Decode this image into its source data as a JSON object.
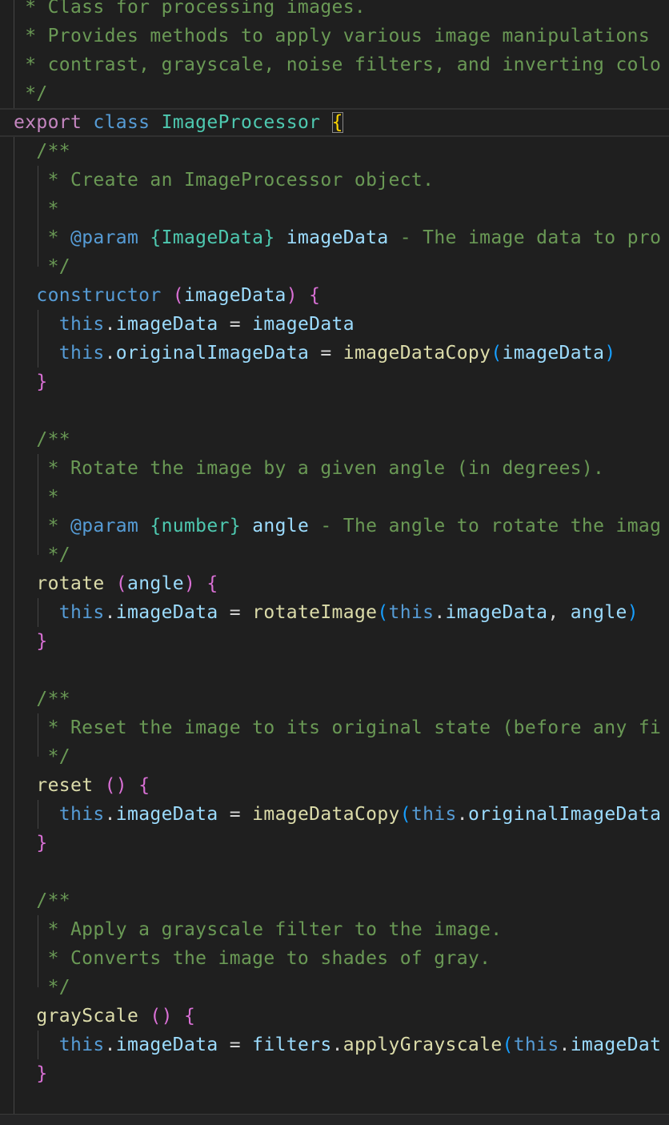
{
  "editor": {
    "colors": {
      "background": "#1f1f1f",
      "comment": "#6a9955",
      "keyword": "#c586c0",
      "storage": "#569cd6",
      "class_name": "#4ec9b0",
      "function": "#dcdcaa",
      "variable": "#9cdcfe",
      "bracket_gold": "#ffd700",
      "bracket_orchid": "#da70d6",
      "bracket_blue": "#179fff"
    },
    "lines": [
      [
        {
          "t": " * Class for processing images.",
          "c": "c-comment"
        }
      ],
      [
        {
          "t": " * Provides methods to apply various image manipulations",
          "c": "c-comment"
        }
      ],
      [
        {
          "t": " * contrast, grayscale, noise filters, and inverting colo",
          "c": "c-comment"
        }
      ],
      [
        {
          "t": " */",
          "c": "c-comment"
        }
      ],
      [
        {
          "t": "export",
          "c": "c-kw"
        },
        {
          "t": " ",
          "c": "c-plain"
        },
        {
          "t": "class",
          "c": "c-storage"
        },
        {
          "t": " ",
          "c": "c-plain"
        },
        {
          "t": "ImageProcessor",
          "c": "c-class"
        },
        {
          "t": " ",
          "c": "c-plain"
        },
        {
          "t": "{",
          "c": "c-brace1 bracket-match"
        }
      ],
      [
        {
          "t": "  /**",
          "c": "c-comment"
        }
      ],
      [
        {
          "t": "   * Create an ImageProcessor object.",
          "c": "c-comment"
        }
      ],
      [
        {
          "t": "   *",
          "c": "c-comment"
        }
      ],
      [
        {
          "t": "   * ",
          "c": "c-comment"
        },
        {
          "t": "@param",
          "c": "c-doctag"
        },
        {
          "t": " ",
          "c": "c-comment"
        },
        {
          "t": "{",
          "c": "c-doctype"
        },
        {
          "t": "ImageData",
          "c": "c-doctype"
        },
        {
          "t": "}",
          "c": "c-doctype"
        },
        {
          "t": " ",
          "c": "c-comment"
        },
        {
          "t": "imageData",
          "c": "c-docparam"
        },
        {
          "t": " - The image data to pro",
          "c": "c-comment"
        }
      ],
      [
        {
          "t": "   */",
          "c": "c-comment"
        }
      ],
      [
        {
          "t": "  ",
          "c": "c-plain"
        },
        {
          "t": "constructor",
          "c": "c-storage"
        },
        {
          "t": " ",
          "c": "c-plain"
        },
        {
          "t": "(",
          "c": "c-brace2"
        },
        {
          "t": "imageData",
          "c": "c-var"
        },
        {
          "t": ")",
          "c": "c-brace2"
        },
        {
          "t": " ",
          "c": "c-plain"
        },
        {
          "t": "{",
          "c": "c-brace2"
        }
      ],
      [
        {
          "t": "    ",
          "c": "c-plain"
        },
        {
          "t": "this",
          "c": "c-storage"
        },
        {
          "t": ".",
          "c": "c-plain"
        },
        {
          "t": "imageData",
          "c": "c-var"
        },
        {
          "t": " = ",
          "c": "c-plain"
        },
        {
          "t": "imageData",
          "c": "c-var"
        }
      ],
      [
        {
          "t": "    ",
          "c": "c-plain"
        },
        {
          "t": "this",
          "c": "c-storage"
        },
        {
          "t": ".",
          "c": "c-plain"
        },
        {
          "t": "originalImageData",
          "c": "c-var"
        },
        {
          "t": " = ",
          "c": "c-plain"
        },
        {
          "t": "imageDataCopy",
          "c": "c-func"
        },
        {
          "t": "(",
          "c": "c-brace3"
        },
        {
          "t": "imageData",
          "c": "c-var"
        },
        {
          "t": ")",
          "c": "c-brace3"
        }
      ],
      [
        {
          "t": "  ",
          "c": "c-plain"
        },
        {
          "t": "}",
          "c": "c-brace2"
        }
      ],
      [],
      [
        {
          "t": "  /**",
          "c": "c-comment"
        }
      ],
      [
        {
          "t": "   * Rotate the image by a given angle (in degrees).",
          "c": "c-comment"
        }
      ],
      [
        {
          "t": "   *",
          "c": "c-comment"
        }
      ],
      [
        {
          "t": "   * ",
          "c": "c-comment"
        },
        {
          "t": "@param",
          "c": "c-doctag"
        },
        {
          "t": " ",
          "c": "c-comment"
        },
        {
          "t": "{",
          "c": "c-doctype"
        },
        {
          "t": "number",
          "c": "c-doctype"
        },
        {
          "t": "}",
          "c": "c-doctype"
        },
        {
          "t": " ",
          "c": "c-comment"
        },
        {
          "t": "angle",
          "c": "c-docparam"
        },
        {
          "t": " - The angle to rotate the imag",
          "c": "c-comment"
        }
      ],
      [
        {
          "t": "   */",
          "c": "c-comment"
        }
      ],
      [
        {
          "t": "  ",
          "c": "c-plain"
        },
        {
          "t": "rotate",
          "c": "c-func"
        },
        {
          "t": " ",
          "c": "c-plain"
        },
        {
          "t": "(",
          "c": "c-brace2"
        },
        {
          "t": "angle",
          "c": "c-var"
        },
        {
          "t": ")",
          "c": "c-brace2"
        },
        {
          "t": " ",
          "c": "c-plain"
        },
        {
          "t": "{",
          "c": "c-brace2"
        }
      ],
      [
        {
          "t": "    ",
          "c": "c-plain"
        },
        {
          "t": "this",
          "c": "c-storage"
        },
        {
          "t": ".",
          "c": "c-plain"
        },
        {
          "t": "imageData",
          "c": "c-var"
        },
        {
          "t": " = ",
          "c": "c-plain"
        },
        {
          "t": "rotateImage",
          "c": "c-func"
        },
        {
          "t": "(",
          "c": "c-brace3"
        },
        {
          "t": "this",
          "c": "c-storage"
        },
        {
          "t": ".",
          "c": "c-plain"
        },
        {
          "t": "imageData",
          "c": "c-var"
        },
        {
          "t": ", ",
          "c": "c-plain"
        },
        {
          "t": "angle",
          "c": "c-var"
        },
        {
          "t": ")",
          "c": "c-brace3"
        }
      ],
      [
        {
          "t": "  ",
          "c": "c-plain"
        },
        {
          "t": "}",
          "c": "c-brace2"
        }
      ],
      [],
      [
        {
          "t": "  /**",
          "c": "c-comment"
        }
      ],
      [
        {
          "t": "   * Reset the image to its original state (before any fi",
          "c": "c-comment"
        }
      ],
      [
        {
          "t": "   */",
          "c": "c-comment"
        }
      ],
      [
        {
          "t": "  ",
          "c": "c-plain"
        },
        {
          "t": "reset",
          "c": "c-func"
        },
        {
          "t": " ",
          "c": "c-plain"
        },
        {
          "t": "()",
          "c": "c-brace2"
        },
        {
          "t": " ",
          "c": "c-plain"
        },
        {
          "t": "{",
          "c": "c-brace2"
        }
      ],
      [
        {
          "t": "    ",
          "c": "c-plain"
        },
        {
          "t": "this",
          "c": "c-storage"
        },
        {
          "t": ".",
          "c": "c-plain"
        },
        {
          "t": "imageData",
          "c": "c-var"
        },
        {
          "t": " = ",
          "c": "c-plain"
        },
        {
          "t": "imageDataCopy",
          "c": "c-func"
        },
        {
          "t": "(",
          "c": "c-brace3"
        },
        {
          "t": "this",
          "c": "c-storage"
        },
        {
          "t": ".",
          "c": "c-plain"
        },
        {
          "t": "originalImageData",
          "c": "c-var"
        }
      ],
      [
        {
          "t": "  ",
          "c": "c-plain"
        },
        {
          "t": "}",
          "c": "c-brace2"
        }
      ],
      [],
      [
        {
          "t": "  /**",
          "c": "c-comment"
        }
      ],
      [
        {
          "t": "   * Apply a grayscale filter to the image.",
          "c": "c-comment"
        }
      ],
      [
        {
          "t": "   * Converts the image to shades of gray.",
          "c": "c-comment"
        }
      ],
      [
        {
          "t": "   */",
          "c": "c-comment"
        }
      ],
      [
        {
          "t": "  ",
          "c": "c-plain"
        },
        {
          "t": "grayScale",
          "c": "c-func"
        },
        {
          "t": " ",
          "c": "c-plain"
        },
        {
          "t": "()",
          "c": "c-brace2"
        },
        {
          "t": " ",
          "c": "c-plain"
        },
        {
          "t": "{",
          "c": "c-brace2"
        }
      ],
      [
        {
          "t": "    ",
          "c": "c-plain"
        },
        {
          "t": "this",
          "c": "c-storage"
        },
        {
          "t": ".",
          "c": "c-plain"
        },
        {
          "t": "imageData",
          "c": "c-var"
        },
        {
          "t": " = ",
          "c": "c-plain"
        },
        {
          "t": "filters",
          "c": "c-var"
        },
        {
          "t": ".",
          "c": "c-plain"
        },
        {
          "t": "applyGrayscale",
          "c": "c-func"
        },
        {
          "t": "(",
          "c": "c-brace3"
        },
        {
          "t": "this",
          "c": "c-storage"
        },
        {
          "t": ".",
          "c": "c-plain"
        },
        {
          "t": "imageDat",
          "c": "c-var"
        }
      ],
      [
        {
          "t": "  ",
          "c": "c-plain"
        },
        {
          "t": "}",
          "c": "c-brace2"
        }
      ],
      []
    ]
  }
}
